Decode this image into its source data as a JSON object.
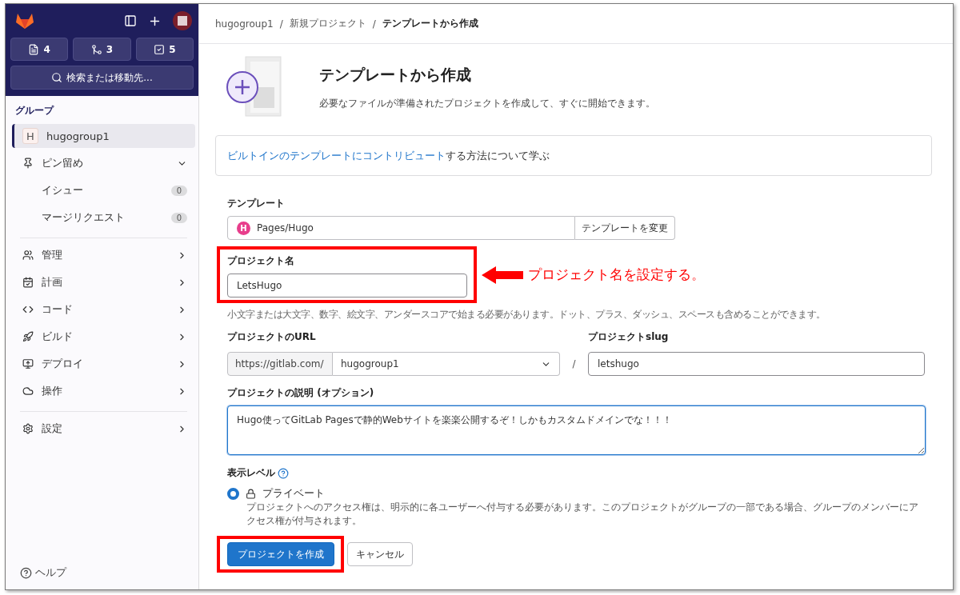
{
  "sidebar": {
    "counters": [
      {
        "kind": "issues",
        "count": "4"
      },
      {
        "kind": "merge_requests",
        "count": "3"
      },
      {
        "kind": "todos",
        "count": "5"
      }
    ],
    "search_button": "検索または移動先...",
    "section_title": "グループ",
    "group": {
      "avatar": "H",
      "label": "hugogroup1",
      "selected": true
    },
    "pinned": {
      "label": "ピン留め",
      "expanded": true,
      "children": [
        {
          "label": "イシュー",
          "count": "0"
        },
        {
          "label": "マージリクエスト",
          "count": "0"
        }
      ]
    },
    "nav": [
      {
        "kind": "manage",
        "label": "管理"
      },
      {
        "kind": "plan",
        "label": "計画"
      },
      {
        "kind": "code",
        "label": "コード"
      },
      {
        "kind": "build",
        "label": "ビルド"
      },
      {
        "kind": "deploy",
        "label": "デプロイ"
      },
      {
        "kind": "operate",
        "label": "操作"
      },
      {
        "kind": "settings",
        "label": "設定"
      }
    ],
    "help": "ヘルプ"
  },
  "breadcrumbs": [
    "hugogroup1",
    "新規プロジェクト",
    "テンプレートから作成"
  ],
  "breadcrumb_separator": "/",
  "header": {
    "title": "テンプレートから作成",
    "subtitle": "必要なファイルが準備されたプロジェクトを作成して、すぐに開始できます。"
  },
  "info": {
    "link": "ビルトインのテンプレートにコントリビュート",
    "text": "する方法について学ぶ"
  },
  "template": {
    "label": "テンプレート",
    "value": "Pages/Hugo",
    "badge": "H",
    "button": "テンプレートを変更"
  },
  "project_name": {
    "label": "プロジェクト名",
    "value": "LetsHugo",
    "hint": "小文字または大文字、数字、絵文字、アンダースコアで始まる必要があります。ドット、プラス、ダッシュ、スペースも含めることができます。"
  },
  "project_url": {
    "label": "プロジェクトのURL",
    "prefix": "https://gitlab.com/",
    "namespace": "hugogroup1",
    "separator": "/"
  },
  "project_slug": {
    "label": "プロジェクトslug",
    "value": "letshugo"
  },
  "description": {
    "label": "プロジェクトの説明 (オプション)",
    "value": "Hugo使ってGitLab Pagesで静的Webサイトを楽楽公開するぞ！しかもカスタムドメインでな！！！"
  },
  "visibility": {
    "label": "表示レベル",
    "options": [
      {
        "label": "プライベート",
        "description": "プロジェクトへのアクセス権は、明示的に各ユーザーへ付与する必要があります。このプロジェクトがグループの一部である場合、グループのメンバーにアクセス権が付与されます。",
        "selected": true
      }
    ]
  },
  "buttons": {
    "create": "プロジェクトを作成",
    "cancel": "キャンセル"
  },
  "annotation": {
    "text": "プロジェクト名を設定する。"
  }
}
